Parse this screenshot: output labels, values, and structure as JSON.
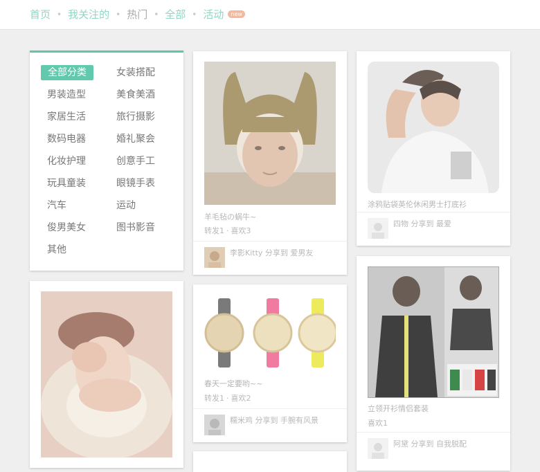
{
  "nav": {
    "items": [
      {
        "label": "首页",
        "active": true
      },
      {
        "label": "我关注的",
        "active": true
      },
      {
        "label": "热门",
        "active": false
      },
      {
        "label": "全部",
        "active": true
      },
      {
        "label": "活动",
        "active": true
      }
    ],
    "badge": "new"
  },
  "categories": [
    "全部分类",
    "女装搭配",
    "男装造型",
    "美食美酒",
    "家居生活",
    "旅行摄影",
    "数码电器",
    "婚礼聚会",
    "化妆护理",
    "创意手工",
    "玩具童装",
    "眼镜手表",
    "汽车",
    "运动",
    "俊男美女",
    "图书影音",
    "其他"
  ],
  "posts": [
    {
      "title": "羊毛毡の蜗牛~",
      "reposts": "转发1",
      "likes": "喜欢3",
      "share": "李影Kitty 分享到 爱男友"
    },
    {
      "title": "涂鸦贴袋英伦休闲男士打底衫",
      "share": "四物 分享到 最爱"
    },
    {
      "title": "春天一定要哟~~",
      "reposts": "转发1",
      "likes": "喜欢2",
      "share": "糯米鸡 分享到 手腕有风景"
    },
    {
      "title": "立领开衫情侣套装",
      "likes": "喜欢1",
      "share": "阿黛 分享到 自我脱配"
    }
  ],
  "colors": {
    "accent": "#5cc7ad",
    "nav_link": "#8fd7c4",
    "badge": "#f6b89b"
  }
}
